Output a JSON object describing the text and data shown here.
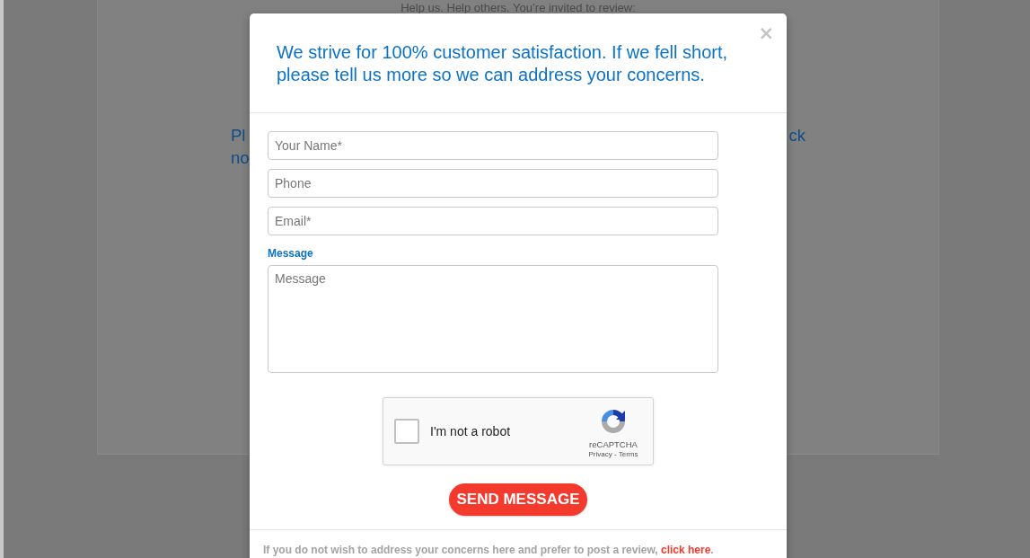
{
  "background": {
    "tagline": "Help us. Help others. You’re invited to review:",
    "heading_left": [
      "Pl",
      "no"
    ],
    "heading_right": "ck"
  },
  "modal": {
    "close": "×",
    "title": "We strive for 100% customer satisfaction. If we fell short, please tell us more so we can address your concerns.",
    "fields": [
      {
        "kind": "input",
        "placeholder": "Your Name*"
      },
      {
        "kind": "input",
        "placeholder": "Phone"
      },
      {
        "kind": "input",
        "placeholder": "Email*"
      },
      {
        "kind": "textarea",
        "label": "Message",
        "placeholder": "Message"
      }
    ],
    "captcha": {
      "checked": false,
      "label": "I'm not a robot",
      "brand": "reCAPTCHA",
      "links": "Privacy - Terms"
    },
    "submit": "SEND MESSAGE",
    "footer": {
      "text": "If you do not wish to address your concerns here and prefer to post a review, ",
      "link": "click here",
      "after": "."
    }
  }
}
